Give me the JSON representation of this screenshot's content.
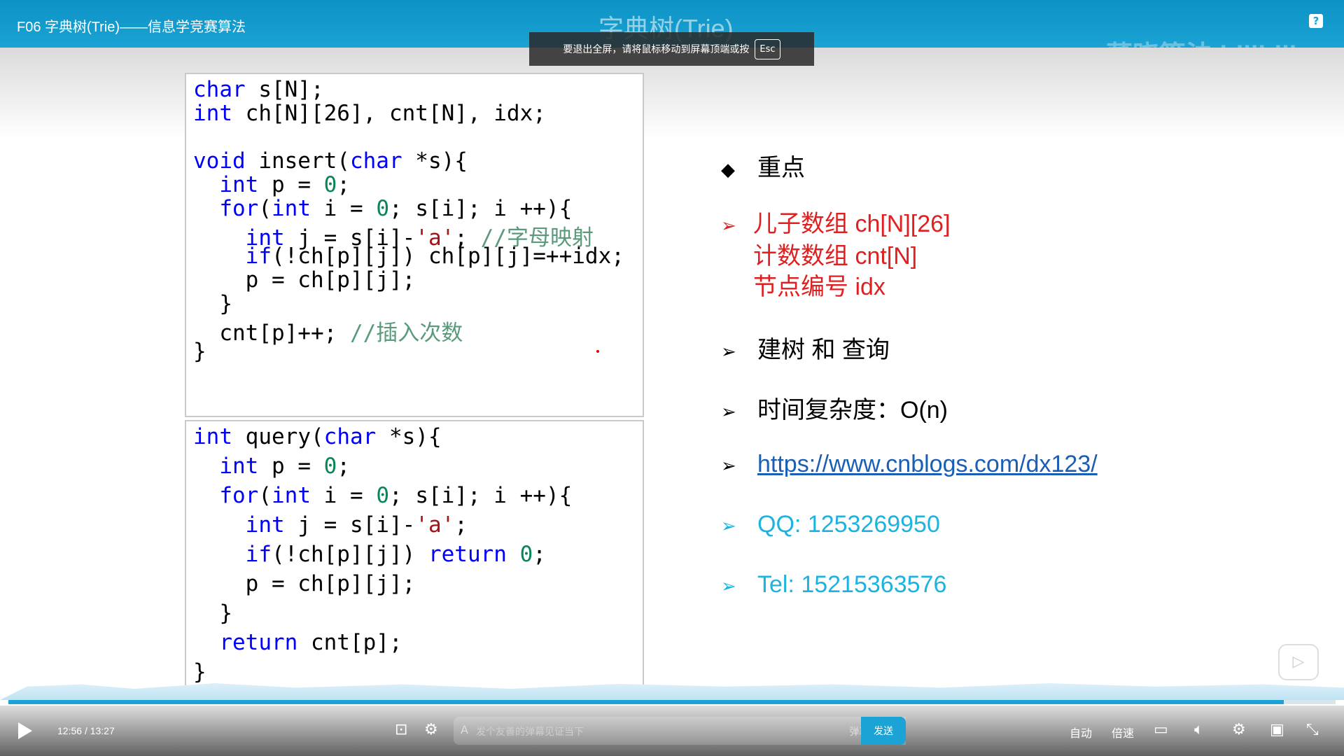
{
  "player": {
    "video_title": "F06 字典树(Trie)——信息学竞赛算法",
    "help_icon": "?",
    "watermark": "董晓算法 bilibili",
    "fullscreen_toast": "要退出全屏，请将鼠标移动到屏幕顶端或按",
    "esc_key": "Esc",
    "current_time": "12:56",
    "time_separator": "/",
    "total_time": "13:27",
    "progress_fraction": 0.961,
    "danmaku_placeholder": "发个友善的弹幕见证当下",
    "danmaku_etiquette": "弹幕礼仪 ›",
    "send_label": "发送",
    "auto_label": "自动",
    "speed_label": "倍速"
  },
  "slide": {
    "title": "字典树(Trie)",
    "bullets": {
      "key_marker": "◆",
      "key": "重点",
      "red_line1": "儿子数组 ch[N][26]",
      "red_line2": "计数数组 cnt[N]",
      "red_line3": "节点编号 idx",
      "build": "建树 和 查询",
      "time": "时间复杂度：O(n)",
      "link": "https://www.cnblogs.com/dx123/",
      "qq": "QQ: 1253269950",
      "tel": "Tel: 15215363576",
      "arrow": "➢"
    }
  },
  "icons": {
    "play": "play-icon",
    "danmaku_toggle": "danmaku-toggle-icon",
    "danmaku_settings": "danmaku-settings-icon",
    "subtitle": "subtitle-off-icon",
    "volume": "volume-icon",
    "settings": "gear-icon",
    "pip": "picture-in-picture-icon",
    "fullscreen": "fullscreen-exit-icon"
  },
  "colors": {
    "brand": "#1aa3d4",
    "keyword": "#0000ff",
    "red": "#e02020",
    "cyan": "#1cb3e0"
  }
}
